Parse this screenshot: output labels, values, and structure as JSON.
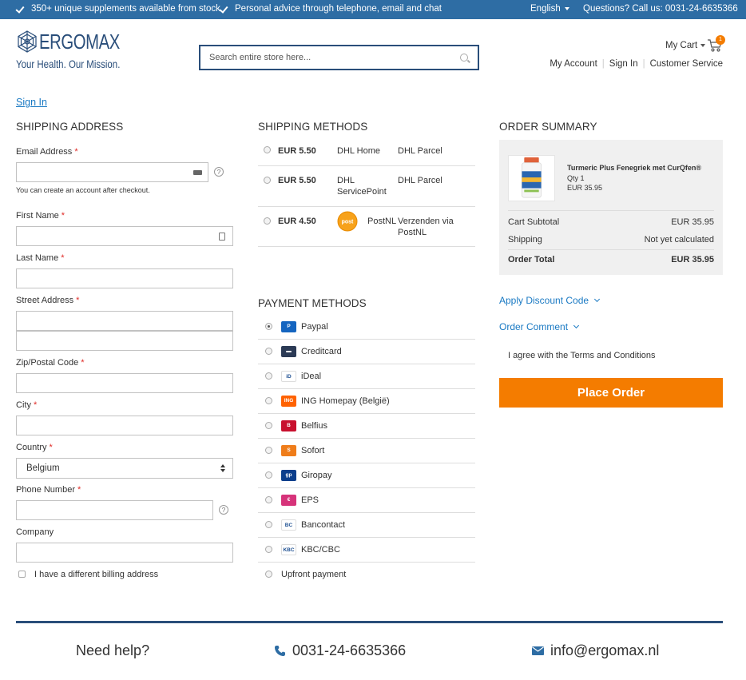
{
  "topbar": {
    "usp1": "350+ unique supplements available from stock",
    "usp2": "Personal advice through telephone, email and chat",
    "language": "English",
    "questions": "Questions? Call us: 0031-24-6635366"
  },
  "header": {
    "logo_word": "ERGOMAX",
    "logo_tagline": "Your Health. Our Mission.",
    "search_placeholder": "Search entire store here...",
    "cart_label": "My Cart",
    "cart_count": "1",
    "links": [
      "My Account",
      "Sign In",
      "Customer Service"
    ]
  },
  "signin_link": "Sign In",
  "shipping_address": {
    "title": "SHIPPING ADDRESS",
    "email_label": "Email Address",
    "email_note": "You can create an account after checkout.",
    "first_name_label": "First Name",
    "last_name_label": "Last Name",
    "street_label": "Street Address",
    "zip_label": "Zip/Postal Code",
    "city_label": "City",
    "country_label": "Country",
    "country_value": "Belgium",
    "phone_label": "Phone Number",
    "company_label": "Company",
    "billing_checkbox": "I have a different billing address",
    "required_mark": "*",
    "help_glyph": "?"
  },
  "shipping_methods": {
    "title": "SHIPPING METHODS",
    "rows": [
      {
        "price": "EUR 5.50",
        "method": "DHL Home",
        "carrier": "DHL Parcel"
      },
      {
        "price": "EUR 5.50",
        "method": "DHL ServicePoint",
        "carrier": "DHL Parcel"
      },
      {
        "price": "EUR 4.50",
        "method": "PostNL",
        "carrier": "Verzenden via PostNL"
      }
    ],
    "postnl_logo_text": "post"
  },
  "payment_methods": {
    "title": "PAYMENT METHODS",
    "selected_index": 0,
    "items": [
      {
        "label": "Paypal",
        "icon": "paypal-icon",
        "color": "#1565c0",
        "glyph": "P"
      },
      {
        "label": "Creditcard",
        "icon": "creditcard-icon",
        "color": "#2b3a55",
        "glyph": "▬"
      },
      {
        "label": "iDeal",
        "icon": "ideal-icon",
        "color": "#ffffff",
        "glyph": "iD"
      },
      {
        "label": "ING Homepay (België)",
        "icon": "ing-icon",
        "color": "#ff6200",
        "glyph": "ING"
      },
      {
        "label": "Belfius",
        "icon": "belfius-icon",
        "color": "#c8102e",
        "glyph": "B"
      },
      {
        "label": "Sofort",
        "icon": "sofort-icon",
        "color": "#ef7d1a",
        "glyph": "S"
      },
      {
        "label": "Giropay",
        "icon": "giropay-icon",
        "color": "#0b3e8c",
        "glyph": "gp"
      },
      {
        "label": "EPS",
        "icon": "eps-icon",
        "color": "#d6337a",
        "glyph": "€"
      },
      {
        "label": "Bancontact",
        "icon": "bancontact-icon",
        "color": "#ffffff",
        "glyph": "BC"
      },
      {
        "label": "KBC/CBC",
        "icon": "kbc-icon",
        "color": "#ffffff",
        "glyph": "KBC"
      },
      {
        "label": "Upfront payment",
        "icon": "",
        "color": "",
        "glyph": ""
      }
    ]
  },
  "order_summary": {
    "title": "ORDER SUMMARY",
    "product_name": "Turmeric Plus Fenegriek met CurQfen®",
    "qty": "Qty 1",
    "product_price": "EUR 35.95",
    "subtotal_label": "Cart Subtotal",
    "subtotal_value": "EUR 35.95",
    "shipping_label": "Shipping",
    "shipping_value": "Not yet calculated",
    "total_label": "Order Total",
    "total_value": "EUR 35.95",
    "discount_link": "Apply Discount Code",
    "comment_link": "Order Comment",
    "terms": "I agree with the Terms and Conditions",
    "place_order": "Place Order"
  },
  "footer": {
    "help": "Need help?",
    "phone": "0031-24-6635366",
    "email": "info@ergomax.nl"
  },
  "colors": {
    "topbar": "#2e6da4",
    "brand": "#2a4e7a",
    "link": "#1979c3",
    "accent": "#f47c00",
    "required": "#e02b27"
  }
}
